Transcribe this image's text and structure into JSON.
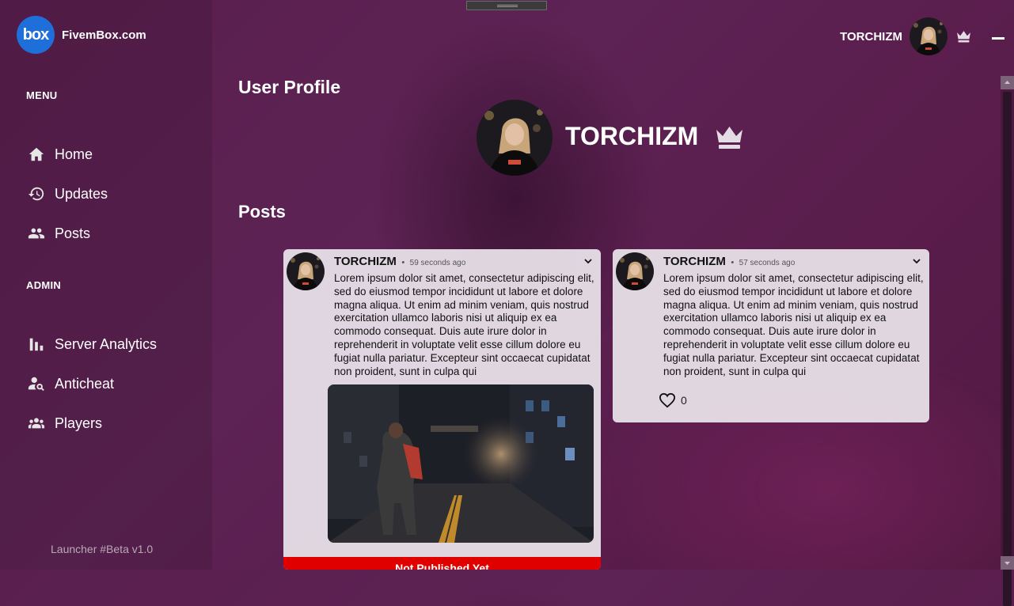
{
  "app": {
    "logo_mark": "box",
    "logo_text": "FivemBox.com",
    "version": "Launcher #Beta v1.0",
    "accent": "#1e6fd9"
  },
  "sidebar": {
    "menu_title": "MENU",
    "menu_items": [
      {
        "label": "Home",
        "icon": "home-icon"
      },
      {
        "label": "Updates",
        "icon": "history-icon"
      },
      {
        "label": "Posts",
        "icon": "people-icon"
      }
    ],
    "admin_title": "ADMIN",
    "admin_items": [
      {
        "label": "Server Analytics",
        "icon": "bar-chart-icon"
      },
      {
        "label": "Anticheat",
        "icon": "user-search-icon"
      },
      {
        "label": "Players",
        "icon": "group-icon"
      }
    ]
  },
  "topbar": {
    "username": "TORCHIZM"
  },
  "profile": {
    "page_title": "User Profile",
    "username": "TORCHIZM",
    "posts_title": "Posts"
  },
  "posts": [
    {
      "author": "TORCHIZM",
      "separator": "•",
      "time": "59 seconds ago",
      "body": "Lorem ipsum dolor sit amet, consectetur adipiscing elit, sed do eiusmod tempor incididunt ut labore et dolore magna aliqua. Ut enim ad minim veniam, quis nostrud exercitation ullamco laboris nisi ut aliquip ex ea commodo consequat. Duis aute irure dolor in reprehenderit in voluptate velit esse cillum dolore eu fugiat nulla pariatur. Excepteur sint occaecat cupidatat non proident, sunt in culpa qui",
      "status": "Not Published Yet",
      "status_color": "#e00000"
    },
    {
      "author": "TORCHIZM",
      "separator": "•",
      "time": "57 seconds ago",
      "body": "Lorem ipsum dolor sit amet, consectetur adipiscing elit, sed do eiusmod tempor incididunt ut labore et dolore magna aliqua. Ut enim ad minim veniam, quis nostrud exercitation ullamco laboris nisi ut aliquip ex ea commodo consequat. Duis aute irure dolor in reprehenderit in voluptate velit esse cillum dolore eu fugiat nulla pariatur. Excepteur sint occaecat cupidatat non proident, sunt in culpa qui",
      "likes": "0"
    }
  ]
}
